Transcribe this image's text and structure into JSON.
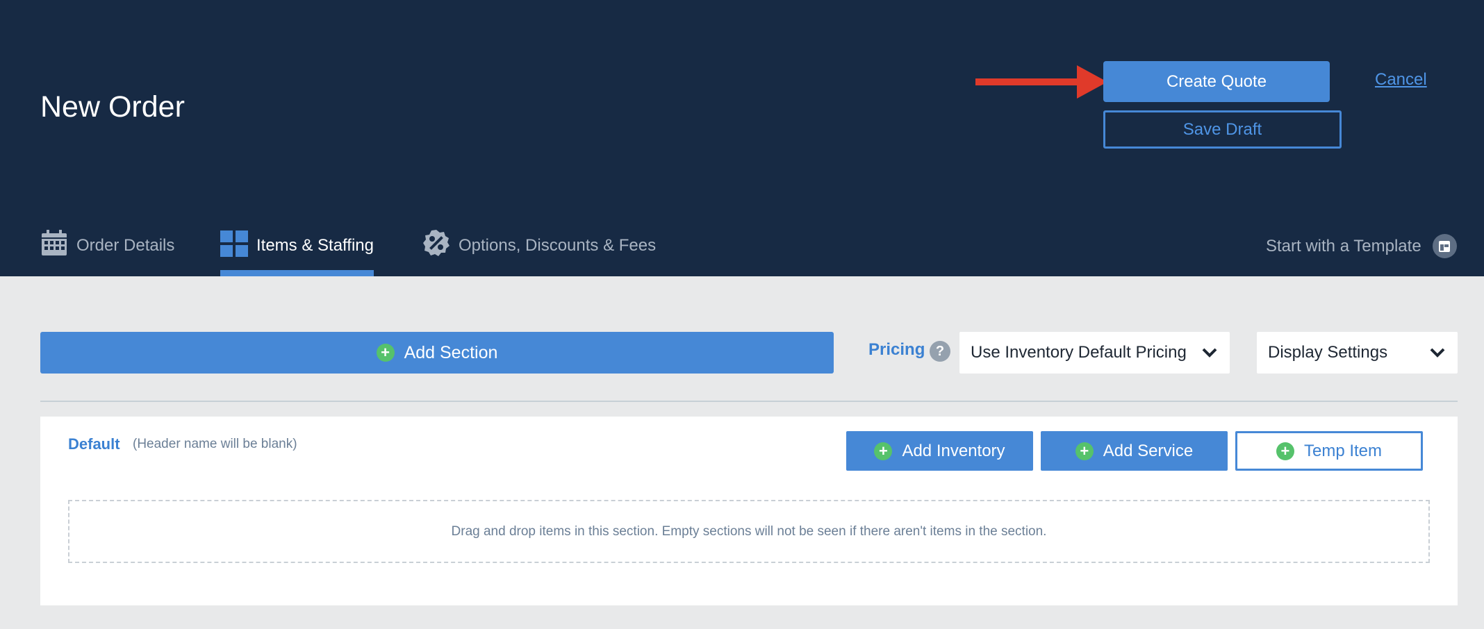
{
  "header": {
    "title": "New Order",
    "create_quote_label": "Create Quote",
    "cancel_label": "Cancel",
    "save_draft_label": "Save Draft"
  },
  "tabs": [
    {
      "label": "Order Details",
      "icon": "calendar-icon",
      "active": false
    },
    {
      "label": "Items & Staffing",
      "icon": "grid-icon",
      "active": true
    },
    {
      "label": "Options, Discounts & Fees",
      "icon": "discount-badge-icon",
      "active": false
    }
  ],
  "template_link": {
    "label": "Start with a Template",
    "icon": "template-icon"
  },
  "toolbar": {
    "add_section_label": "Add Section",
    "pricing_label": "Pricing",
    "pricing_help_icon": "?",
    "pricing_select_value": "Use Inventory Default Pricing",
    "display_settings_value": "Display Settings"
  },
  "section": {
    "name": "Default",
    "hint": "(Header name will be blank)",
    "add_inventory_label": "Add Inventory",
    "add_service_label": "Add Service",
    "temp_item_label": "Temp Item",
    "drop_zone_text": "Drag and drop items in this section. Empty sections will not be seen if there aren't items in the section."
  },
  "colors": {
    "header_bg": "#172a44",
    "accent": "#4688d6",
    "plus": "#56c26b",
    "arrow": "#e03a2a"
  }
}
